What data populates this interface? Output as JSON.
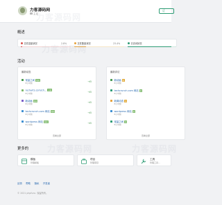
{
  "header": {
    "title": "力客源码网",
    "subtitle": "主站",
    "button_label": "订"
  },
  "overview": {
    "title": "概述",
    "items": [
      {
        "label": "文件容量状况",
        "value": "2.8%",
        "fraction": 0.028,
        "color": "#d9534f"
      },
      {
        "label": "文件数量状况",
        "value": "23.4%",
        "fraction": 0.234,
        "color": "#e6a23c"
      },
      {
        "label": "已访问状况",
        "value": "",
        "fraction": 0.9,
        "color": "#2d9c74"
      }
    ]
  },
  "activity": {
    "title": "活动",
    "left_card": {
      "header": "最新动态",
      "rows": [
        {
          "name": "常量之间",
          "badge": "新闻",
          "badge_class": "b-green",
          "sub": "8小时前",
          "color": "#4a9a52"
        },
        {
          "name": "recharts.com/ch…",
          "badge": "文档",
          "badge_class": "b-green",
          "sub": "8小时前",
          "color": "#7cb86a"
        },
        {
          "name": "新动画",
          "badge": "新闻",
          "badge_class": "b-green",
          "sub": "8小时前",
          "color": "#7a5cc8"
        },
        {
          "name": "techcrunch.com 网站",
          "badge": "新闻",
          "badge_class": "b-green",
          "sub": "8小时前",
          "color": "#3d8fd1"
        },
        {
          "name": "wordpress 网站",
          "badge": "新闻",
          "badge_class": "b-green",
          "sub": "8小时前",
          "color": "#3d8fd1"
        }
      ],
      "footer": "查看全部"
    },
    "right_card": {
      "header": "最新评论",
      "rows": [
        {
          "name": "新动画",
          "badge": "新",
          "badge_class": "b-amber",
          "sub": "8小时前",
          "color": "#4a9a52"
        },
        {
          "name": "techcrunch.com 网站",
          "badge": "新",
          "badge_class": "b-green",
          "sub": "8小时前",
          "color": "#2d9c74"
        },
        {
          "name": "新闻动态",
          "badge": "新",
          "badge_class": "b-amber",
          "sub": "8小时前",
          "color": "#e6a23c"
        },
        {
          "name": "wordpress 网站",
          "badge": "新",
          "badge_class": "b-green",
          "sub": "8小时前",
          "color": "#3d8fd1"
        },
        {
          "name": "常量之间",
          "badge": "新",
          "badge_class": "b-green",
          "sub": "8小时前",
          "color": "#2d9c74"
        }
      ],
      "footer": "查看全部"
    }
  },
  "more": {
    "title": "更多的",
    "cards": [
      {
        "name": "模板",
        "desc": "管理模板",
        "color": "#2d9c74"
      },
      {
        "name": "项目",
        "desc": "管理项目",
        "color": "#2d9c74"
      },
      {
        "name": "工具",
        "desc": "管理工具...",
        "color": "#2d9c74"
      }
    ]
  },
  "footer": {
    "links": [
      "反馈",
      "帮助",
      "隐私",
      "开发者"
    ],
    "copyright": "© 2021 phpfunc. 保留所有。"
  },
  "watermark": "力客源码网"
}
